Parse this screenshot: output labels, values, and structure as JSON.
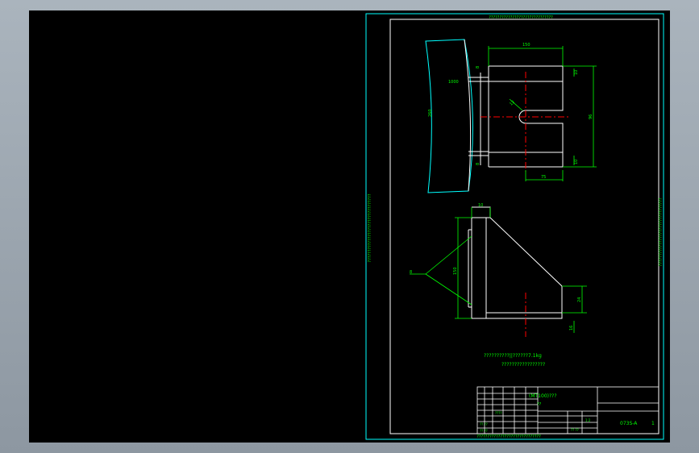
{
  "colors": {
    "background": "#000000",
    "border": "#00ffff",
    "line": "#ffffff",
    "dimension": "#00ff00",
    "center": "#ff0000",
    "text": "#00ff00"
  },
  "side_labels": {
    "top": "??????????????????????????????",
    "left": "????????????????????????????????",
    "right": "????????????????????????????????",
    "bottom": "??????????????????????????????"
  },
  "dims": {
    "d_top": "150",
    "d_radius": "1000",
    "d_left_small": "8",
    "d_r12": "12",
    "d_right_top": "10",
    "d_right_total": "96",
    "d_right_bot": "10",
    "d_bottom": "75",
    "d_left_bot": "8",
    "d_arc": "260",
    "d_top2": "10",
    "d_height2": "150",
    "d_right2": "24",
    "d_thk2": "16",
    "d_leader": "8"
  },
  "notes": {
    "line1": "??????????||??????7.1kg",
    "line2": "?????????????????"
  },
  "title_block": {
    "part_name": "(MT100)???",
    "sub": "??",
    "drawing_no": "073S-A",
    "sheet": "1",
    "row_a": "????",
    "row_b": "?? ??",
    "row_c": "?? ??",
    "row_d": "?? ??",
    "scale": "1:2"
  }
}
